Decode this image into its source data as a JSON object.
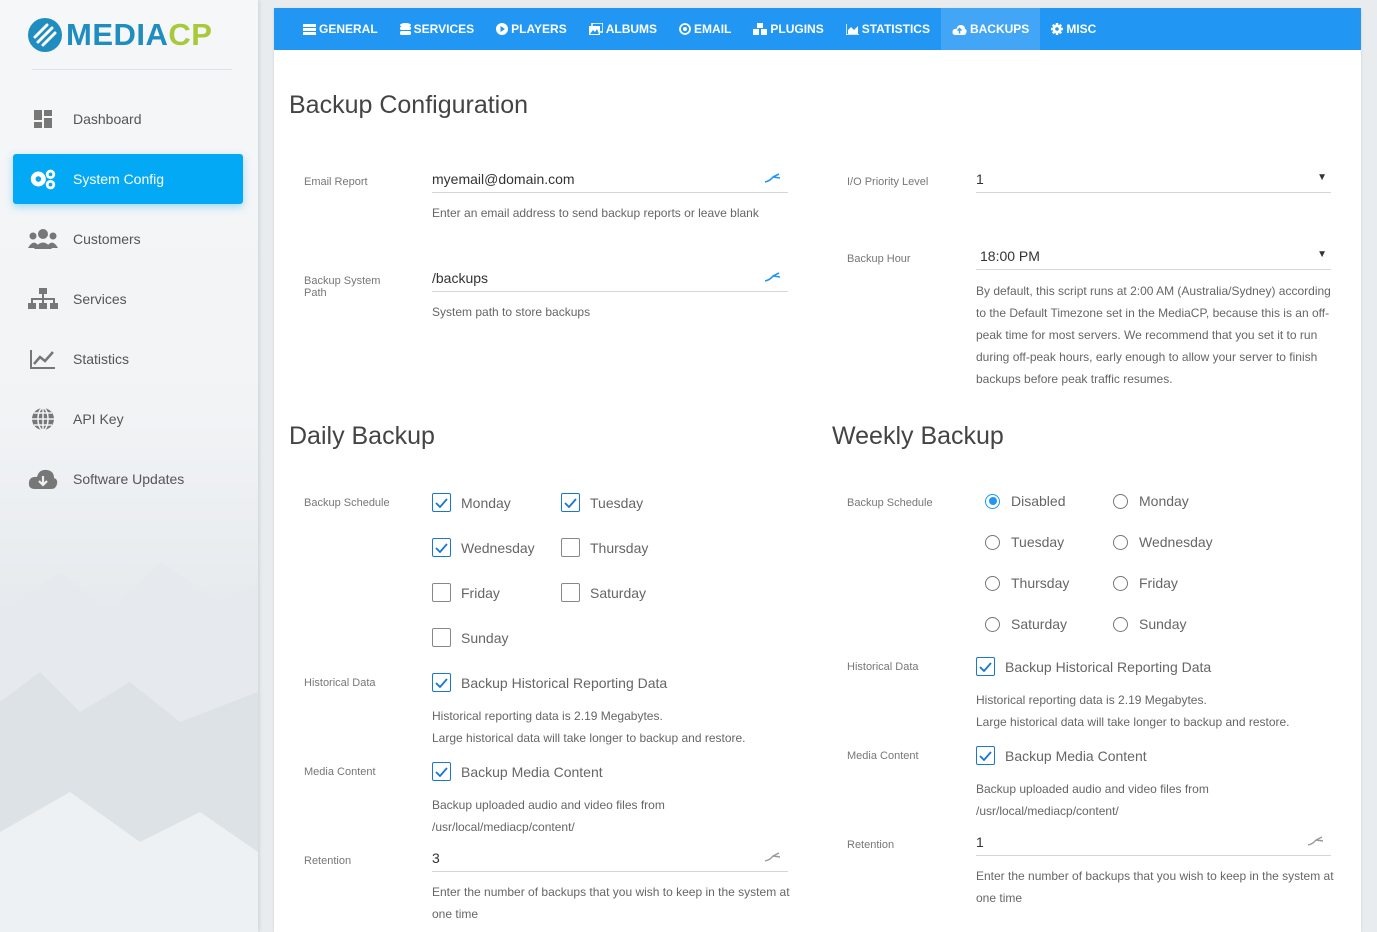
{
  "brand": {
    "part1": "MEDIA",
    "part2": "CP",
    "color1": "#1f8dbf",
    "color2": "#a8c93a"
  },
  "sidebar": {
    "items": [
      {
        "label": "Dashboard",
        "icon": "dashboard-icon"
      },
      {
        "label": "System Config",
        "icon": "gears-icon",
        "active": true
      },
      {
        "label": "Customers",
        "icon": "users-icon"
      },
      {
        "label": "Services",
        "icon": "sitemap-icon"
      },
      {
        "label": "Statistics",
        "icon": "chart-line-icon"
      },
      {
        "label": "API Key",
        "icon": "globe-icon"
      },
      {
        "label": "Software Updates",
        "icon": "cloud-download-icon"
      }
    ]
  },
  "tabs": [
    {
      "label": "GENERAL",
      "icon": "list-icon"
    },
    {
      "label": "SERVICES",
      "icon": "database-icon"
    },
    {
      "label": "PLAYERS",
      "icon": "play-circle-icon"
    },
    {
      "label": "ALBUMS",
      "icon": "images-icon"
    },
    {
      "label": "EMAIL",
      "icon": "at-icon"
    },
    {
      "label": "PLUGINS",
      "icon": "cubes-icon"
    },
    {
      "label": "STATISTICS",
      "icon": "area-chart-icon"
    },
    {
      "label": "BACKUPS",
      "icon": "cloud-upload-icon",
      "active": true
    },
    {
      "label": "MISC",
      "icon": "cog-icon"
    }
  ],
  "accent": "#2196f3",
  "config": {
    "title": "Backup Configuration",
    "email_label": "Email Report",
    "email_value": "myemail@domain.com",
    "email_help": "Enter an email address to send backup reports or leave blank",
    "path_label": "Backup System Path",
    "path_value": "/backups",
    "path_help": "System path to store backups",
    "io_label": "I/O Priority Level",
    "io_value": "1",
    "hour_label": "Backup Hour",
    "hour_value": "18:00 PM",
    "hour_help": [
      "By default, this script runs at 2:00 AM (Australia/Sydney) according",
      "to the Default Timezone set in the MediaCP, because this is an off-",
      "peak time for most servers. We recommend that you set it to run",
      "during off-peak hours, early enough to allow your server to finish",
      "backups before peak traffic resumes."
    ]
  },
  "daily": {
    "title": "Daily Backup",
    "schedule_label": "Backup Schedule",
    "days": [
      {
        "label": "Monday",
        "checked": true
      },
      {
        "label": "Tuesday",
        "checked": true
      },
      {
        "label": "Wednesday",
        "checked": true
      },
      {
        "label": "Thursday",
        "checked": false
      },
      {
        "label": "Friday",
        "checked": false
      },
      {
        "label": "Saturday",
        "checked": false
      },
      {
        "label": "Sunday",
        "checked": false
      }
    ],
    "hist_label": "Historical Data",
    "hist_check": "Backup Historical Reporting Data",
    "hist_help1": "Historical reporting data is 2.19 Megabytes.",
    "hist_help2": "Large historical data will take longer to backup and restore.",
    "media_label": "Media Content",
    "media_check": "Backup Media Content",
    "media_help1": "Backup uploaded audio and video files from",
    "media_help2": "/usr/local/mediacp/content/",
    "ret_label": "Retention",
    "ret_value": "3",
    "ret_help1": "Enter the number of backups that you wish to keep in the system at",
    "ret_help2": "one time"
  },
  "weekly": {
    "title": "Weekly Backup",
    "schedule_label": "Backup Schedule",
    "options": [
      {
        "label": "Disabled",
        "selected": true
      },
      {
        "label": "Monday",
        "selected": false
      },
      {
        "label": "Tuesday",
        "selected": false
      },
      {
        "label": "Wednesday",
        "selected": false
      },
      {
        "label": "Thursday",
        "selected": false
      },
      {
        "label": "Friday",
        "selected": false
      },
      {
        "label": "Saturday",
        "selected": false
      },
      {
        "label": "Sunday",
        "selected": false
      }
    ],
    "hist_label": "Historical Data",
    "hist_check": "Backup Historical Reporting Data",
    "hist_help1": "Historical reporting data is 2.19 Megabytes.",
    "hist_help2": "Large historical data will take longer to backup and restore.",
    "media_label": "Media Content",
    "media_check": "Backup Media Content",
    "media_help1": "Backup uploaded audio and video files from",
    "media_help2": "/usr/local/mediacp/content/",
    "ret_label": "Retention",
    "ret_value": "1",
    "ret_help1": "Enter the number of backups that you wish to keep in the system at",
    "ret_help2": "one time"
  }
}
